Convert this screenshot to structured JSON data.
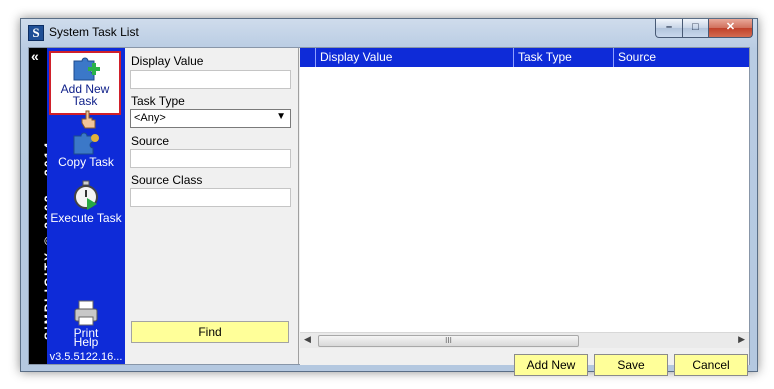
{
  "window": {
    "title": "System Task List"
  },
  "brand": {
    "collapse": "«",
    "vertical_text": "SIMPLICITY © 2002 - 2014"
  },
  "actions": {
    "add_new_task": "Add New Task",
    "copy_task": "Copy Task",
    "execute_task": "Execute Task",
    "print": "Print",
    "help": "Help",
    "version": "v3.5.5122.16..."
  },
  "filters": {
    "display_value_label": "Display Value",
    "display_value": "",
    "task_type_label": "Task Type",
    "task_type_selected": "<Any>",
    "source_label": "Source",
    "source": "",
    "source_class_label": "Source Class",
    "source_class": "",
    "find_label": "Find"
  },
  "grid": {
    "columns": [
      "Display Value",
      "Task Type",
      "Source"
    ],
    "rows": [],
    "scroll_thumb": "III"
  },
  "footer": {
    "add_new": "Add New",
    "save": "Save",
    "cancel": "Cancel"
  },
  "colors": {
    "accent_blue": "#0e2bd8",
    "button_yellow": "#ffff99",
    "highlight_red": "#d0202a"
  }
}
